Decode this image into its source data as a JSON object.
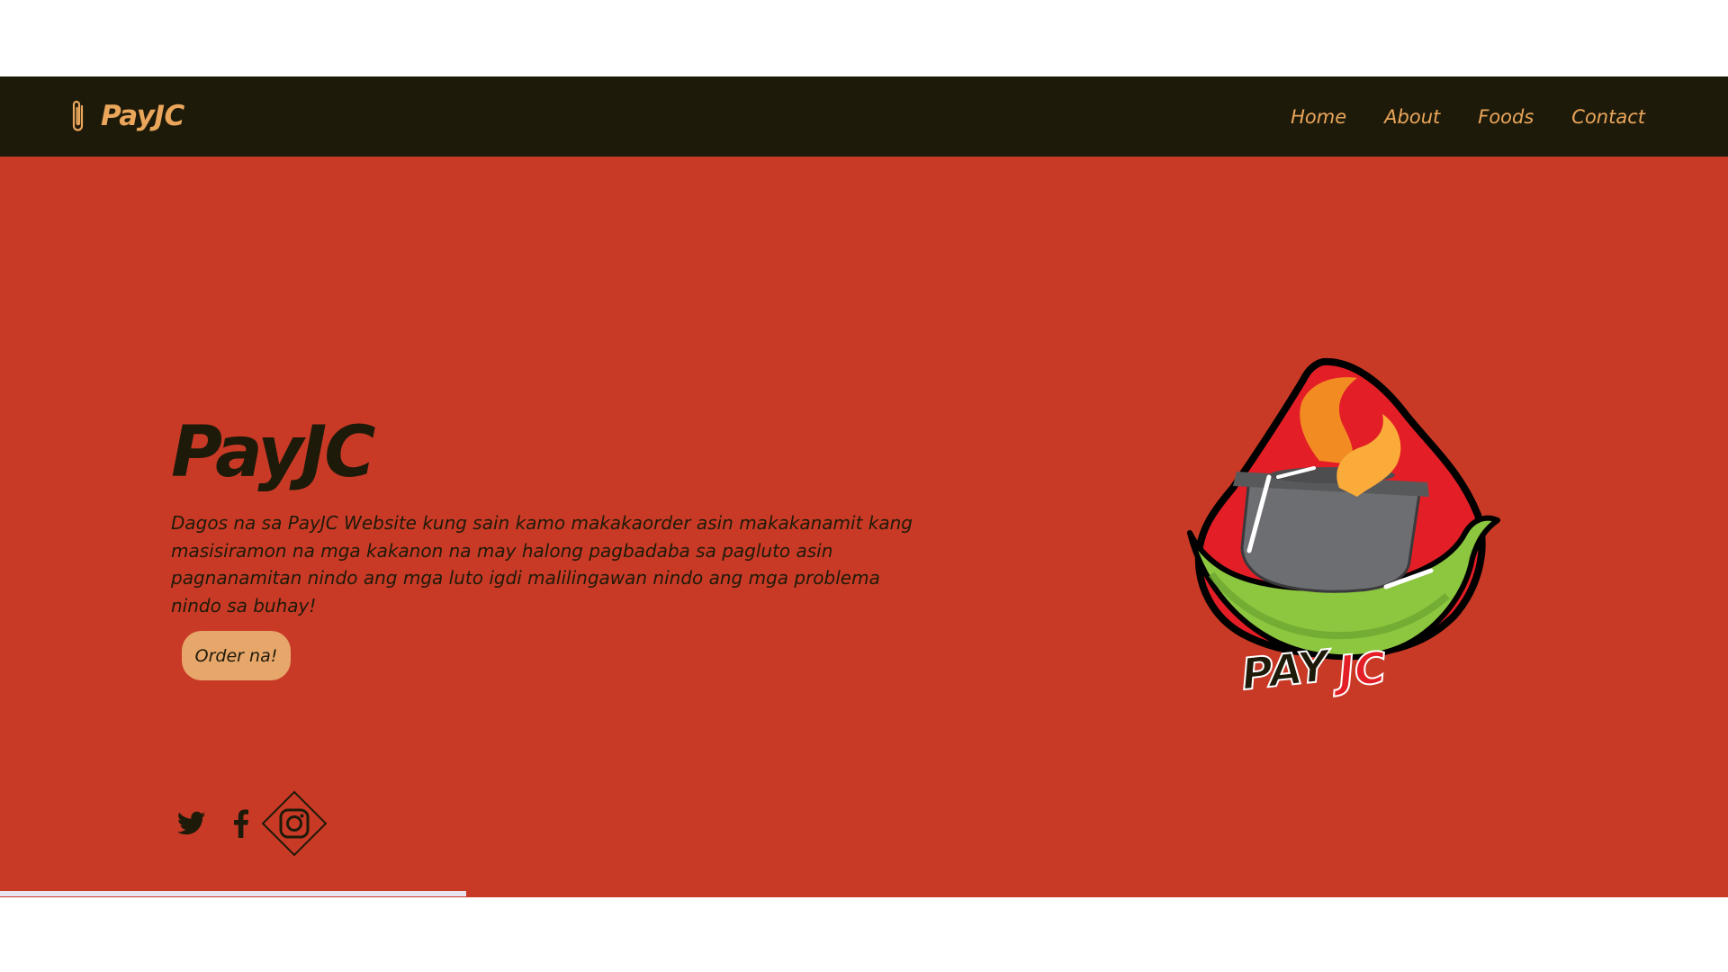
{
  "navbar": {
    "brand": "PayJC",
    "links": [
      {
        "label": "Home"
      },
      {
        "label": "About"
      },
      {
        "label": "Foods"
      },
      {
        "label": "Contact"
      }
    ]
  },
  "hero": {
    "title": "PayJC",
    "description": "Dagos na sa PayJC Website kung sain kamo makakaorder asin makakanamit kang masisiramon na mga kakanon na may halong pagbadaba sa pagluto asin pagnanamitan nindo ang mga luto igdi malilingawan nindo ang mga problema nindo sa buhay!",
    "order_button": "Order na!",
    "logo_text_left": "PAY",
    "logo_text_right": "JC"
  },
  "socials": [
    {
      "icon": "twitter-icon"
    },
    {
      "icon": "facebook-icon"
    },
    {
      "icon": "instagram-icon"
    }
  ],
  "colors": {
    "navbar_bg": "#1e1a09",
    "accent": "#eaa65b",
    "hero_bg": "#c93a26",
    "button_bg": "#e7a76b",
    "text_dark": "#1e1a09"
  }
}
